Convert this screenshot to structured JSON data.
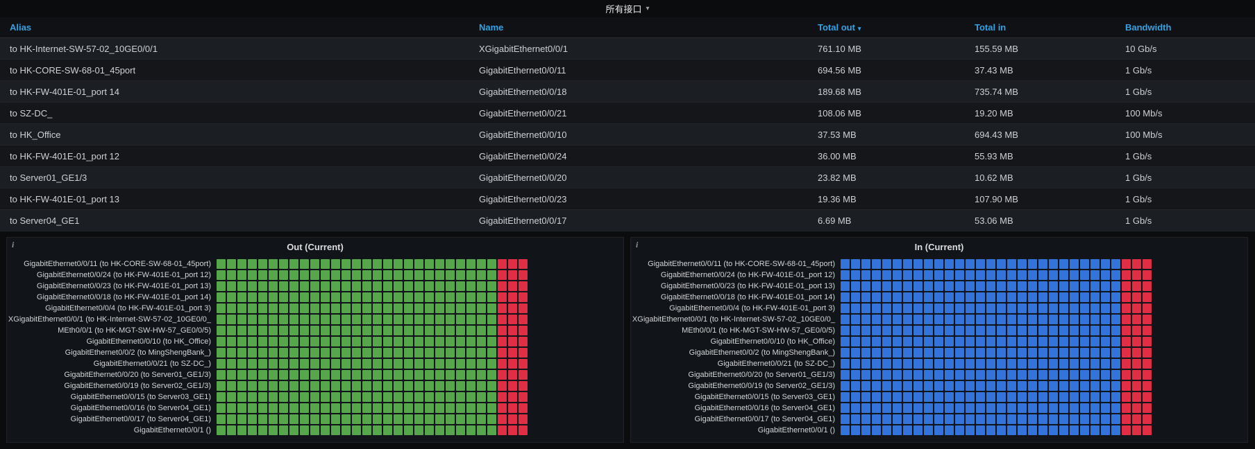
{
  "header": {
    "title": "所有接口"
  },
  "icons": {
    "chevron_down": "▾",
    "sort_desc": "▾",
    "info": "i"
  },
  "colors": {
    "header_link": "#33a2e5",
    "green": "#56A64B",
    "blue": "#3274D9",
    "red": "#E02F44"
  },
  "table": {
    "columns": [
      {
        "label": "Alias",
        "sorted": false
      },
      {
        "label": "Name",
        "sorted": false
      },
      {
        "label": "Total out",
        "sorted": true,
        "direction": "desc"
      },
      {
        "label": "Total in",
        "sorted": false
      },
      {
        "label": "Bandwidth",
        "sorted": false
      }
    ],
    "rows": [
      [
        "to HK-Internet-SW-57-02_10GE0/0/1",
        "XGigabitEthernet0/0/1",
        "761.10 MB",
        "155.59 MB",
        "10 Gb/s"
      ],
      [
        "to HK-CORE-SW-68-01_45port",
        "GigabitEthernet0/0/11",
        "694.56 MB",
        "37.43 MB",
        "1 Gb/s"
      ],
      [
        "to HK-FW-401E-01_port 14",
        "GigabitEthernet0/0/18",
        "189.68 MB",
        "735.74 MB",
        "1 Gb/s"
      ],
      [
        "to SZ-DC_",
        "GigabitEthernet0/0/21",
        "108.06 MB",
        "19.20 MB",
        "100 Mb/s"
      ],
      [
        "to HK_Office",
        "GigabitEthernet0/0/10",
        "37.53 MB",
        "694.43 MB",
        "100 Mb/s"
      ],
      [
        "to HK-FW-401E-01_port 12",
        "GigabitEthernet0/0/24",
        "36.00 MB",
        "55.93 MB",
        "1 Gb/s"
      ],
      [
        "to Server01_GE1/3",
        "GigabitEthernet0/0/20",
        "23.82 MB",
        "10.62 MB",
        "1 Gb/s"
      ],
      [
        "to HK-FW-401E-01_port 13",
        "GigabitEthernet0/0/23",
        "19.36 MB",
        "107.90 MB",
        "1 Gb/s"
      ],
      [
        "to Server04_GE1",
        "GigabitEthernet0/0/17",
        "6.69 MB",
        "53.06 MB",
        "1 Gb/s"
      ]
    ]
  },
  "panels": [
    {
      "title": "Out (Current)",
      "status_color": "#56A64B",
      "alert_color": "#E02F44",
      "cells_ok": 27,
      "cells_alert": 3,
      "rows": [
        "GigabitEthernet0/0/11 (to HK-CORE-SW-68-01_45port)",
        "GigabitEthernet0/0/24 (to HK-FW-401E-01_port 12)",
        "GigabitEthernet0/0/23 (to HK-FW-401E-01_port 13)",
        "GigabitEthernet0/0/18 (to HK-FW-401E-01_port 14)",
        "GigabitEthernet0/0/4 (to HK-FW-401E-01_port 3)",
        "XGigabitEthernet0/0/1 (to HK-Internet-SW-57-02_10GE0/0_",
        "MEth0/0/1 (to HK-MGT-SW-HW-57_GE0/0/5)",
        "GigabitEthernet0/0/10 (to HK_Office)",
        "GigabitEthernet0/0/2 (to MingShengBank_)",
        "GigabitEthernet0/0/21 (to SZ-DC_)",
        "GigabitEthernet0/0/20 (to Server01_GE1/3)",
        "GigabitEthernet0/0/19 (to Server02_GE1/3)",
        "GigabitEthernet0/0/15 (to Server03_GE1)",
        "GigabitEthernet0/0/16 (to Server04_GE1)",
        "GigabitEthernet0/0/17 (to Server04_GE1)",
        "GigabitEthernet0/0/1 ()"
      ]
    },
    {
      "title": "In (Current)",
      "status_color": "#3274D9",
      "alert_color": "#E02F44",
      "cells_ok": 27,
      "cells_alert": 3,
      "rows": [
        "GigabitEthernet0/0/11 (to HK-CORE-SW-68-01_45port)",
        "GigabitEthernet0/0/24 (to HK-FW-401E-01_port 12)",
        "GigabitEthernet0/0/23 (to HK-FW-401E-01_port 13)",
        "GigabitEthernet0/0/18 (to HK-FW-401E-01_port 14)",
        "GigabitEthernet0/0/4 (to HK-FW-401E-01_port 3)",
        "XGigabitEthernet0/0/1 (to HK-Internet-SW-57-02_10GE0/0_",
        "MEth0/0/1 (to HK-MGT-SW-HW-57_GE0/0/5)",
        "GigabitEthernet0/0/10 (to HK_Office)",
        "GigabitEthernet0/0/2 (to MingShengBank_)",
        "GigabitEthernet0/0/21 (to SZ-DC_)",
        "GigabitEthernet0/0/20 (to Server01_GE1/3)",
        "GigabitEthernet0/0/19 (to Server02_GE1/3)",
        "GigabitEthernet0/0/15 (to Server03_GE1)",
        "GigabitEthernet0/0/16 (to Server04_GE1)",
        "GigabitEthernet0/0/17 (to Server04_GE1)",
        "GigabitEthernet0/0/1 ()"
      ]
    }
  ],
  "chart_data": [
    {
      "type": "heatmap",
      "title": "Out (Current)",
      "xlabel": "",
      "ylabel": "",
      "legend_position": "none",
      "grid": false,
      "categories": [
        "GigabitEthernet0/0/11 (to HK-CORE-SW-68-01_45port)",
        "GigabitEthernet0/0/24 (to HK-FW-401E-01_port 12)",
        "GigabitEthernet0/0/23 (to HK-FW-401E-01_port 13)",
        "GigabitEthernet0/0/18 (to HK-FW-401E-01_port 14)",
        "GigabitEthernet0/0/4 (to HK-FW-401E-01_port 3)",
        "XGigabitEthernet0/0/1 (to HK-Internet-SW-57-02_10GE0/0_",
        "MEth0/0/1 (to HK-MGT-SW-HW-57_GE0/0/5)",
        "GigabitEthernet0/0/10 (to HK_Office)",
        "GigabitEthernet0/0/2 (to MingShengBank_)",
        "GigabitEthernet0/0/21 (to SZ-DC_)",
        "GigabitEthernet0/0/20 (to Server01_GE1/3)",
        "GigabitEthernet0/0/19 (to Server02_GE1/3)",
        "GigabitEthernet0/0/15 (to Server03_GE1)",
        "GigabitEthernet0/0/16 (to Server04_GE1)",
        "GigabitEthernet0/0/17 (to Server04_GE1)",
        "GigabitEthernet0/0/1 ()"
      ],
      "time_buckets": 30,
      "row_pattern_all_rows": {
        "ok_buckets": 27,
        "alert_buckets": 3,
        "ok_color": "#56A64B",
        "alert_color": "#E02F44"
      }
    },
    {
      "type": "heatmap",
      "title": "In (Current)",
      "xlabel": "",
      "ylabel": "",
      "legend_position": "none",
      "grid": false,
      "categories": [
        "GigabitEthernet0/0/11 (to HK-CORE-SW-68-01_45port)",
        "GigabitEthernet0/0/24 (to HK-FW-401E-01_port 12)",
        "GigabitEthernet0/0/23 (to HK-FW-401E-01_port 13)",
        "GigabitEthernet0/0/18 (to HK-FW-401E-01_port 14)",
        "GigabitEthernet0/0/4 (to HK-FW-401E-01_port 3)",
        "XGigabitEthernet0/0/1 (to HK-Internet-SW-57-02_10GE0/0_",
        "MEth0/0/1 (to HK-MGT-SW-HW-57_GE0/0/5)",
        "GigabitEthernet0/0/10 (to HK_Office)",
        "GigabitEthernet0/0/2 (to MingShengBank_)",
        "GigabitEthernet0/0/21 (to SZ-DC_)",
        "GigabitEthernet0/0/20 (to Server01_GE1/3)",
        "GigabitEthernet0/0/19 (to Server02_GE1/3)",
        "GigabitEthernet0/0/15 (to Server03_GE1)",
        "GigabitEthernet0/0/16 (to Server04_GE1)",
        "GigabitEthernet0/0/17 (to Server04_GE1)",
        "GigabitEthernet0/0/1 ()"
      ],
      "time_buckets": 30,
      "row_pattern_all_rows": {
        "ok_buckets": 27,
        "alert_buckets": 3,
        "ok_color": "#3274D9",
        "alert_color": "#E02F44"
      }
    }
  ]
}
